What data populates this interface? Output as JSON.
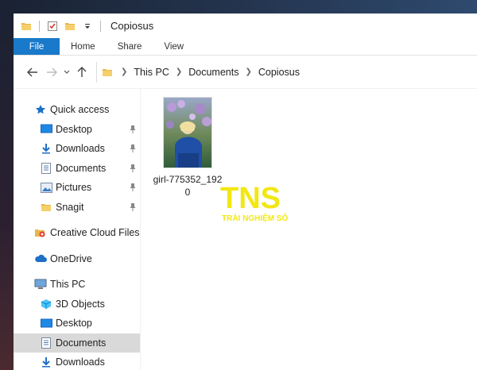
{
  "window": {
    "title": "Copiosus"
  },
  "ribbon": {
    "tabs": [
      {
        "label": "File"
      },
      {
        "label": "Home"
      },
      {
        "label": "Share"
      },
      {
        "label": "View"
      }
    ]
  },
  "address": {
    "crumbs": [
      "This PC",
      "Documents",
      "Copiosus"
    ]
  },
  "sidebar": {
    "quick_access": "Quick access",
    "quick_items": [
      {
        "label": "Desktop"
      },
      {
        "label": "Downloads"
      },
      {
        "label": "Documents"
      },
      {
        "label": "Pictures"
      },
      {
        "label": "Snagit"
      }
    ],
    "creative_cloud": "Creative Cloud Files",
    "onedrive": "OneDrive",
    "this_pc": "This PC",
    "pc_items": [
      {
        "label": "3D Objects"
      },
      {
        "label": "Desktop"
      },
      {
        "label": "Documents"
      },
      {
        "label": "Downloads"
      }
    ]
  },
  "content": {
    "files": [
      {
        "name": "girl-775352_1920"
      }
    ]
  },
  "watermark": {
    "logo": "TNS",
    "tagline": "TRẢI NGHIỆM SỐ"
  },
  "colors": {
    "file_tab": "#1979ca",
    "folder": "#e8b84a",
    "selected": "#d9d9d9",
    "watermark": "#f1e600"
  }
}
